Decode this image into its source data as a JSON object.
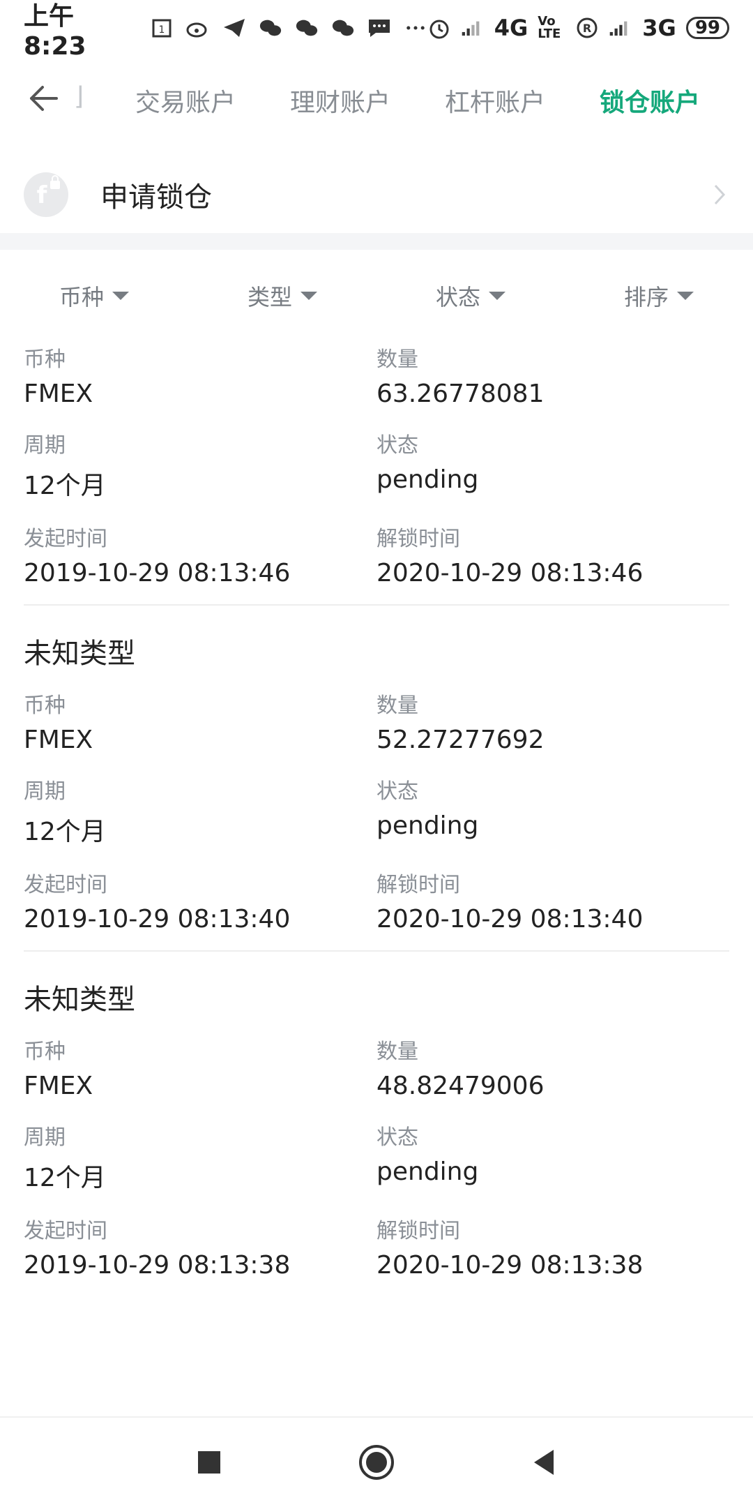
{
  "status_bar": {
    "time": "上午8:23",
    "network_4g": "4G",
    "network_3g": "3G",
    "volte": "Vo LTE",
    "battery": "99"
  },
  "tabs": [
    {
      "label": "交易账户",
      "active": false
    },
    {
      "label": "理财账户",
      "active": false
    },
    {
      "label": "杠杆账户",
      "active": false
    },
    {
      "label": "锁仓账户",
      "active": true
    }
  ],
  "apply": {
    "label": "申请锁仓"
  },
  "filters": [
    {
      "label": "币种"
    },
    {
      "label": "类型"
    },
    {
      "label": "状态"
    },
    {
      "label": "排序"
    }
  ],
  "field_labels": {
    "coin": "币种",
    "amount": "数量",
    "period": "周期",
    "status": "状态",
    "start_time": "发起时间",
    "unlock_time": "解锁时间"
  },
  "records": [
    {
      "title": "",
      "coin": "FMEX",
      "amount": "63.26778081",
      "period": "12个月",
      "status": "pending",
      "start_time": "2019-10-29 08:13:46",
      "unlock_time": "2020-10-29 08:13:46"
    },
    {
      "title": "未知类型",
      "coin": "FMEX",
      "amount": "52.27277692",
      "period": "12个月",
      "status": "pending",
      "start_time": "2019-10-29 08:13:40",
      "unlock_time": "2020-10-29 08:13:40"
    },
    {
      "title": "未知类型",
      "coin": "FMEX",
      "amount": "48.82479006",
      "period": "12个月",
      "status": "pending",
      "start_time": "2019-10-29 08:13:38",
      "unlock_time": "2020-10-29 08:13:38"
    }
  ],
  "colors": {
    "accent": "#15a87b",
    "muted": "#888d93"
  }
}
